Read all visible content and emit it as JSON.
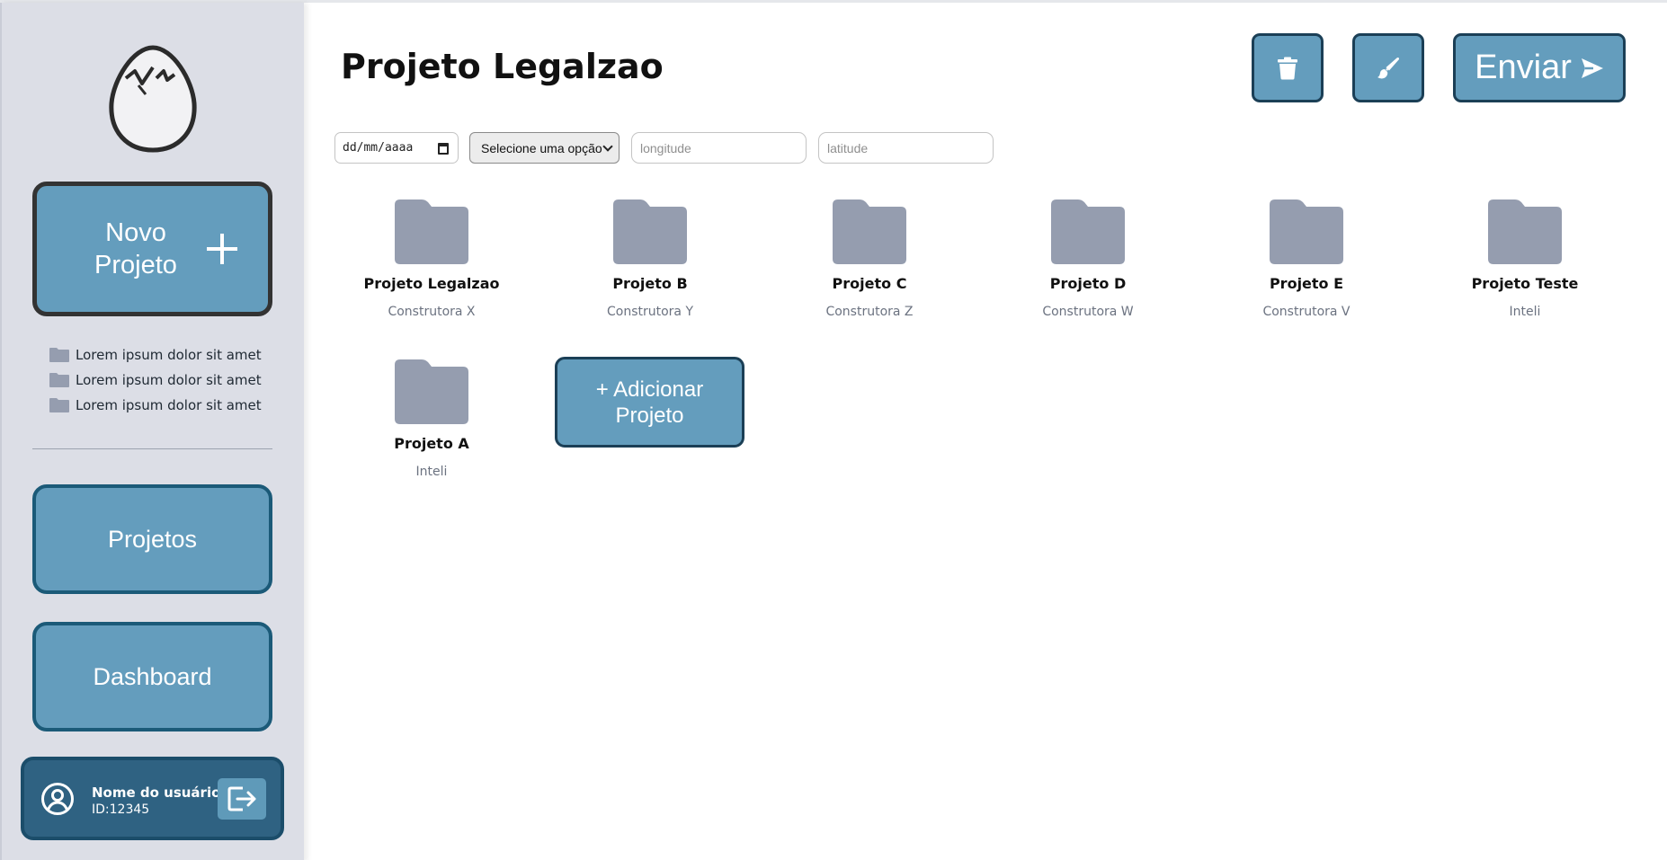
{
  "sidebar": {
    "new_project_label": "Novo Projeto",
    "recent_projects": [
      {
        "label": "Lorem ipsum dolor sit amet"
      },
      {
        "label": "Lorem ipsum dolor sit amet"
      },
      {
        "label": "Lorem ipsum dolor sit amet"
      }
    ],
    "nav": {
      "projetos": "Projetos",
      "dashboard": "Dashboard"
    },
    "user": {
      "name": "Nome do usuário",
      "id": "ID:12345"
    }
  },
  "header": {
    "title": "Projeto Legalzao",
    "send_label": "Enviar"
  },
  "filters": {
    "date_placeholder": "dd/mm/aaaa",
    "select_value": "Selecione uma opção",
    "longitude_placeholder": "longitude",
    "latitude_placeholder": "latitude"
  },
  "projects": [
    {
      "name": "Projeto Legalzao",
      "company": "Construtora X"
    },
    {
      "name": "Projeto B",
      "company": "Construtora Y"
    },
    {
      "name": "Projeto C",
      "company": "Construtora Z"
    },
    {
      "name": "Projeto D",
      "company": "Construtora W"
    },
    {
      "name": "Projeto E",
      "company": "Construtora V"
    },
    {
      "name": "Projeto Teste",
      "company": "Inteli"
    },
    {
      "name": "Projeto A",
      "company": "Inteli"
    }
  ],
  "add_project_label": "+ Adicionar Projeto",
  "colors": {
    "accent": "#649dbd",
    "accent_border": "#1b5a78",
    "user_card": "#2f6282",
    "folder": "#959daf",
    "sidebar_bg": "#dcdee6"
  },
  "icons": {
    "logo": "cracked-egg-icon",
    "plus": "plus-icon",
    "folder": "folder-icon",
    "trash": "trash-icon",
    "brush": "brush-icon",
    "send": "send-icon",
    "user": "user-circle-icon",
    "logout": "logout-icon",
    "calendar": "calendar-icon"
  }
}
